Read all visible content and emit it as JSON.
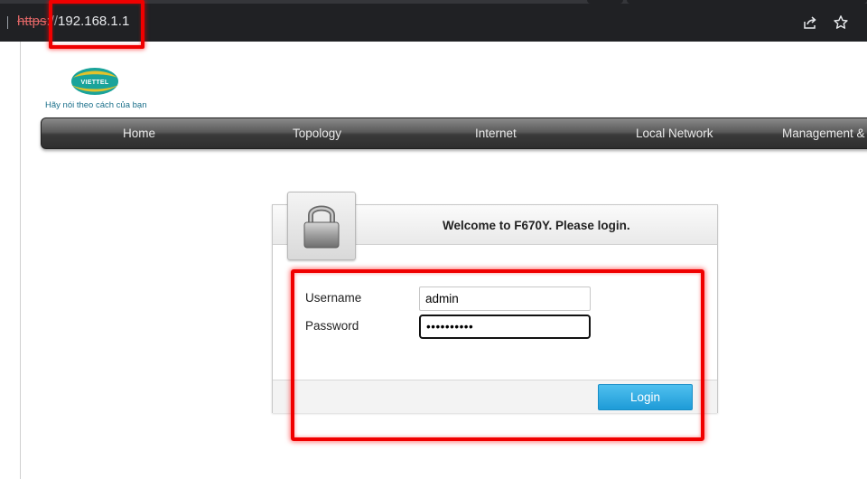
{
  "browser": {
    "url_scheme": "https",
    "url_separator": "://",
    "url_host": "192.168.1.1",
    "share_icon": "share-icon",
    "bookmark_icon": "star-icon"
  },
  "logo": {
    "brand": "VIETTEL",
    "tagline": "Hãy nói theo cách của bạn"
  },
  "nav": {
    "items": [
      "Home",
      "Topology",
      "Internet",
      "Local Network",
      "Management &"
    ]
  },
  "login": {
    "title": "Welcome to F670Y. Please login.",
    "username_label": "Username",
    "username_value": "admin",
    "password_label": "Password",
    "password_value": "••••••••••",
    "button_label": "Login",
    "lock_icon": "padlock-icon"
  },
  "colors": {
    "highlight": "#f00000",
    "button": "#1e9bd7",
    "navbar": "#3a3a3a"
  }
}
